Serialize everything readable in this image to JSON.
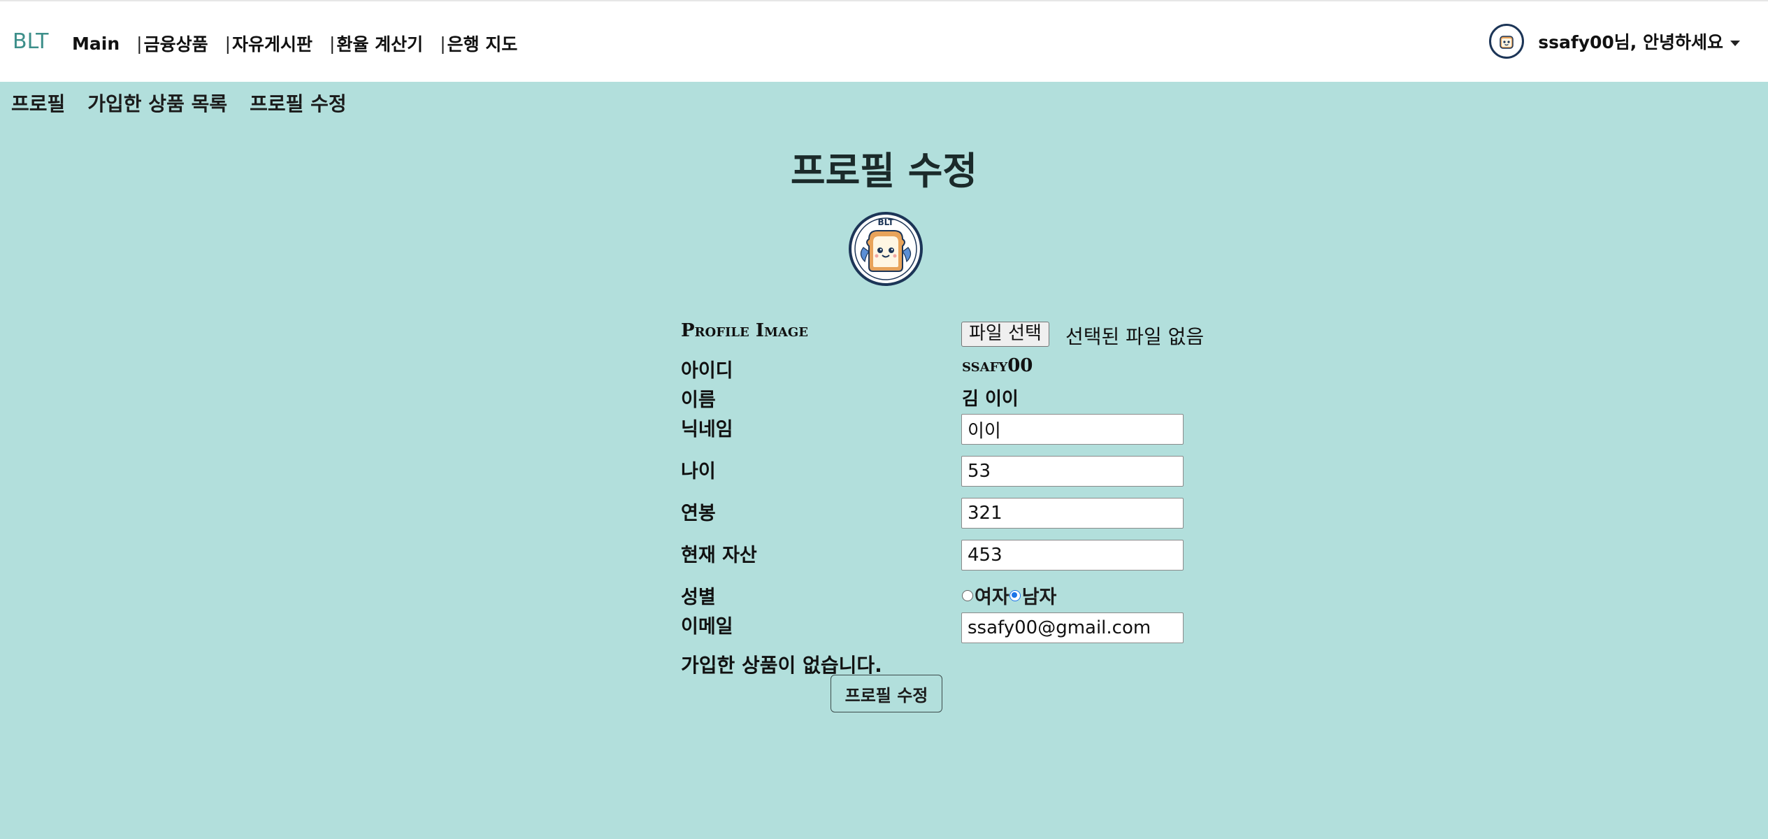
{
  "app": {
    "brand": "BLT"
  },
  "nav": {
    "items": [
      {
        "label": "Main"
      },
      {
        "label": "금융상품"
      },
      {
        "label": "자유게시판"
      },
      {
        "label": "환율 계산기"
      },
      {
        "label": "은행 지도"
      }
    ],
    "separator": "|"
  },
  "user": {
    "greeting": "ssafy00님, 안녕하세요",
    "avatar_icon": "blt-toast-logo-icon"
  },
  "subnav": {
    "items": [
      {
        "label": "프로필"
      },
      {
        "label": "가입한 상품 목록"
      },
      {
        "label": "프로필 수정"
      }
    ]
  },
  "page": {
    "title": "프로필 수정",
    "avatar_icon": "blt-toast-logo-icon",
    "avatar_text": "BLT"
  },
  "form": {
    "profile_image": {
      "label": "Profile Image",
      "button_label": "파일 선택",
      "status": "선택된 파일 없음"
    },
    "username": {
      "label": "아이디",
      "value": "ssafy00"
    },
    "name": {
      "label": "이름",
      "value": "김 이이"
    },
    "nickname": {
      "label": "닉네임",
      "value": "이이"
    },
    "age": {
      "label": "나이",
      "value": "53"
    },
    "salary": {
      "label": "연봉",
      "value": "321"
    },
    "assets": {
      "label": "현재 자산",
      "value": "453"
    },
    "gender": {
      "label": "성별",
      "options": [
        {
          "label": "여자",
          "checked": false
        },
        {
          "label": "남자",
          "checked": true
        }
      ]
    },
    "email": {
      "label": "이메일",
      "value": "ssafy00@gmail.com"
    },
    "no_products_text": "가입한 상품이 없습니다.",
    "submit_label": "프로필 수정"
  },
  "colors": {
    "background": "#b2dfdc",
    "brand": "#3d8f8a",
    "topbar": "#ffffff",
    "radio_accent": "#1a73e8"
  }
}
